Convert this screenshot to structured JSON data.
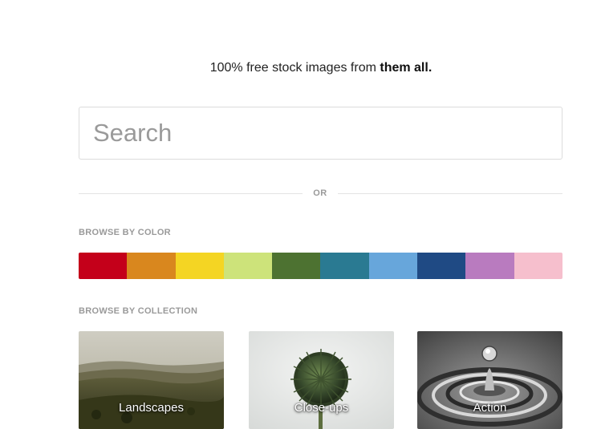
{
  "hero": {
    "tagline_prefix": "100% free stock images from ",
    "tagline_bold": "them all."
  },
  "search": {
    "placeholder": "Search",
    "value": ""
  },
  "divider": {
    "label": "OR"
  },
  "browse_color": {
    "label": "BROWSE BY COLOR",
    "colors": [
      "#c4001a",
      "#d9871e",
      "#f4d523",
      "#cde37a",
      "#4d7231",
      "#2a7a92",
      "#67a6db",
      "#1f4a84",
      "#b97bbf",
      "#f6bfcd"
    ]
  },
  "browse_collection": {
    "label": "BROWSE BY COLLECTION",
    "items": [
      {
        "label": "Landscapes"
      },
      {
        "label": "Close-ups"
      },
      {
        "label": "Action"
      }
    ]
  }
}
